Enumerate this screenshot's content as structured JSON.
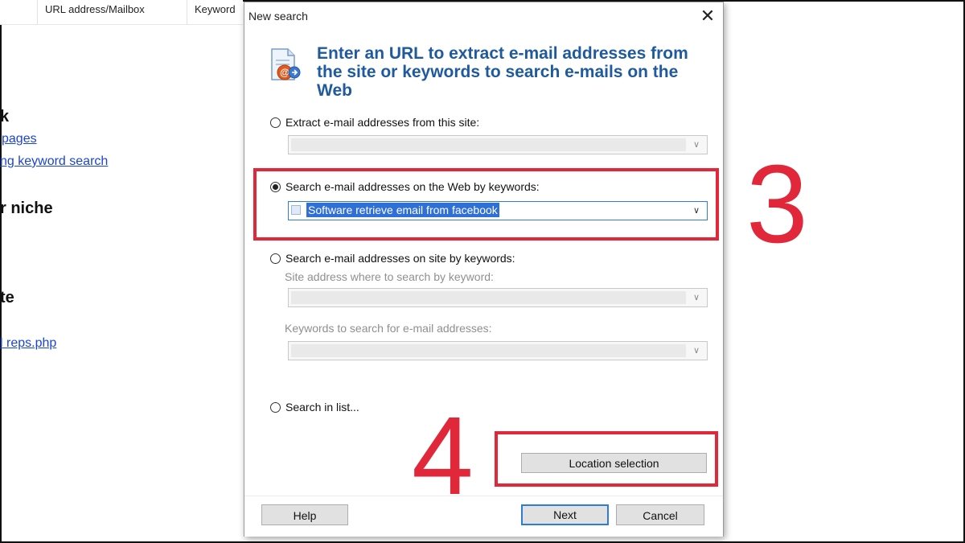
{
  "background": {
    "columns": [
      "URL address/Mailbox",
      "Keyword"
    ],
    "snippets": [
      "k",
      "pages",
      "ng keyword search",
      "r niche",
      "te",
      "l reps.php"
    ]
  },
  "dialog": {
    "title": "New search",
    "heading": "Enter an URL to extract e-mail addresses from the site or keywords to search e-mails on the Web",
    "options": {
      "extract_site": "Extract e-mail addresses from this site:",
      "web_keywords": "Search e-mail addresses on the Web by keywords:",
      "site_keywords": "Search e-mail addresses on site by keywords:",
      "in_list": "Search in list..."
    },
    "selected_option": "web_keywords",
    "keyword_value": "Software retrieve email from facebook",
    "site_address_label": "Site address where to search by keyword:",
    "keywords_label": "Keywords to search for e-mail addresses:",
    "location_button": "Location selection",
    "help_button": "Help",
    "next_button": "Next",
    "cancel_button": "Cancel"
  },
  "annotations": {
    "step_3": "3",
    "step_4": "4",
    "color": "#e0283a"
  }
}
